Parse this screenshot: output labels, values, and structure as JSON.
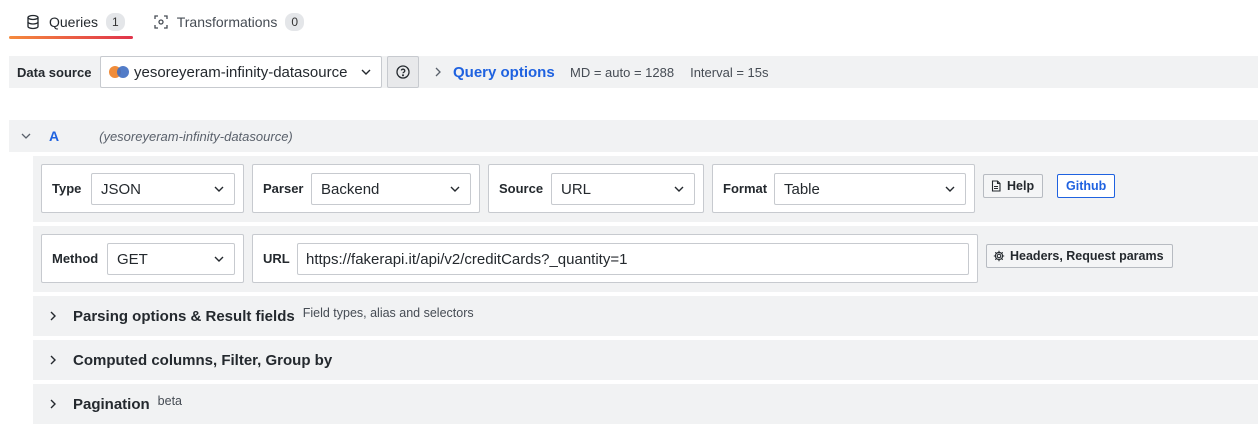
{
  "tabs": [
    {
      "label": "Queries",
      "count": "1",
      "icon": "database-icon"
    },
    {
      "label": "Transformations",
      "count": "0",
      "icon": "transform-icon"
    }
  ],
  "datasource": {
    "label": "Data source",
    "selected": "yesoreyeram-infinity-datasource",
    "query_options_label": "Query options",
    "md": "MD = auto = 1288",
    "interval": "Interval = 15s"
  },
  "query": {
    "name": "A",
    "datasource": "(yesoreyeram-infinity-datasource)",
    "type": {
      "label": "Type",
      "value": "JSON"
    },
    "parser": {
      "label": "Parser",
      "value": "Backend"
    },
    "source": {
      "label": "Source",
      "value": "URL"
    },
    "format": {
      "label": "Format",
      "value": "Table"
    },
    "help_label": "Help",
    "github_label": "Github",
    "method": {
      "label": "Method",
      "value": "GET"
    },
    "url": {
      "label": "URL",
      "value": "https://fakerapi.it/api/v2/creditCards?_quantity=1"
    },
    "headers_label": "Headers, Request params"
  },
  "sections": [
    {
      "title": "Parsing options & Result fields",
      "desc": "Field types, alias and selectors"
    },
    {
      "title": "Computed columns, Filter, Group by",
      "desc": ""
    },
    {
      "title": "Pagination",
      "desc": "beta"
    }
  ],
  "colors": {
    "accent": "#1f62e0",
    "tab_underline_start": "#f58a3d",
    "tab_underline_end": "#e0334b",
    "panel_bg": "#f1f2f3"
  }
}
